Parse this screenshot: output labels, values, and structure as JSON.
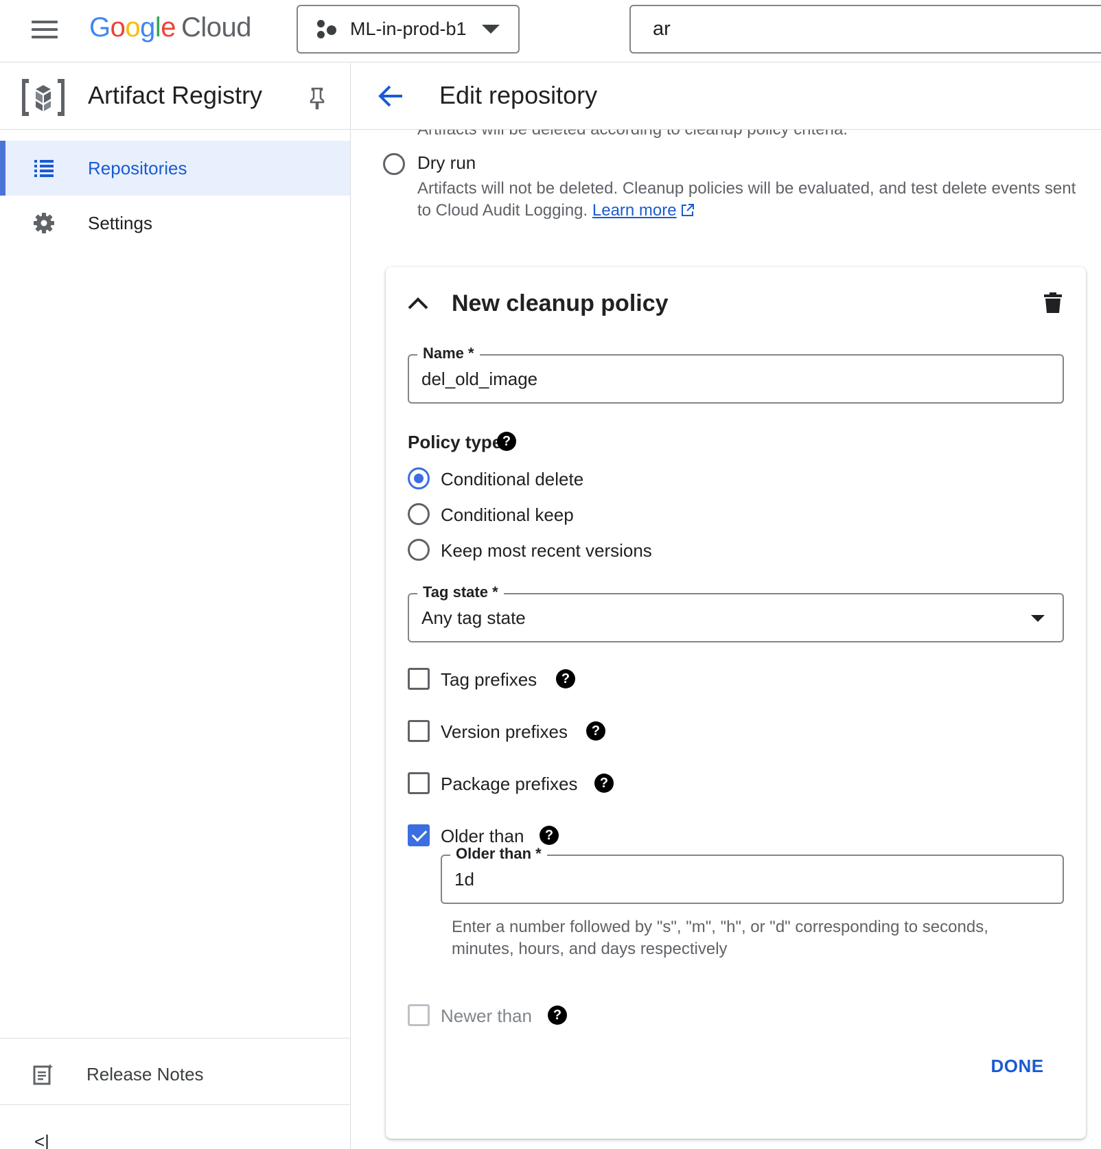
{
  "topbar": {
    "logo": {
      "g1": "G",
      "o1": "o",
      "o2": "o",
      "g2": "g",
      "l": "l",
      "e": "e",
      "cloud": "Cloud"
    },
    "project": "ML-in-prod-b1",
    "search_value": "ar"
  },
  "sidebar": {
    "title": "Artifact Registry",
    "items": [
      {
        "label": "Repositories",
        "icon": "list-icon",
        "active": true
      },
      {
        "label": "Settings",
        "icon": "gear-icon",
        "active": false
      }
    ],
    "release_notes": "Release Notes",
    "collapse_glyph": "<|"
  },
  "main": {
    "title": "Edit repository",
    "cut_text": "Artifacts will be deleted according to cleanup policy criteria.",
    "dry_run": {
      "label": "Dry run",
      "desc": "Artifacts will not be deleted. Cleanup policies will be evaluated, and test delete events sent to Cloud Audit Logging.",
      "link": "Learn more"
    },
    "policy": {
      "title": "New cleanup policy",
      "name_label": "Name *",
      "name_value": "del_old_image",
      "policy_type_label": "Policy type",
      "policy_types": [
        "Conditional delete",
        "Conditional keep",
        "Keep most recent versions"
      ],
      "selected_policy_type": "Conditional delete",
      "tag_state_label": "Tag state *",
      "tag_state_value": "Any tag state",
      "filters": [
        {
          "label": "Tag prefixes",
          "checked": false
        },
        {
          "label": "Version prefixes",
          "checked": false
        },
        {
          "label": "Package prefixes",
          "checked": false
        },
        {
          "label": "Older than",
          "checked": true
        }
      ],
      "older_than_label": "Older than *",
      "older_than_value": "1d",
      "older_than_hint": "Enter a number followed by \"s\", \"m\", \"h\", or \"d\" corresponding to seconds, minutes, hours, and days respectively",
      "newer_than_label": "Newer than",
      "done_label": "DONE"
    }
  },
  "colors": {
    "accent": "#3b6ee0",
    "link": "#1a5bd1",
    "active_bg": "#e8f0fe"
  }
}
